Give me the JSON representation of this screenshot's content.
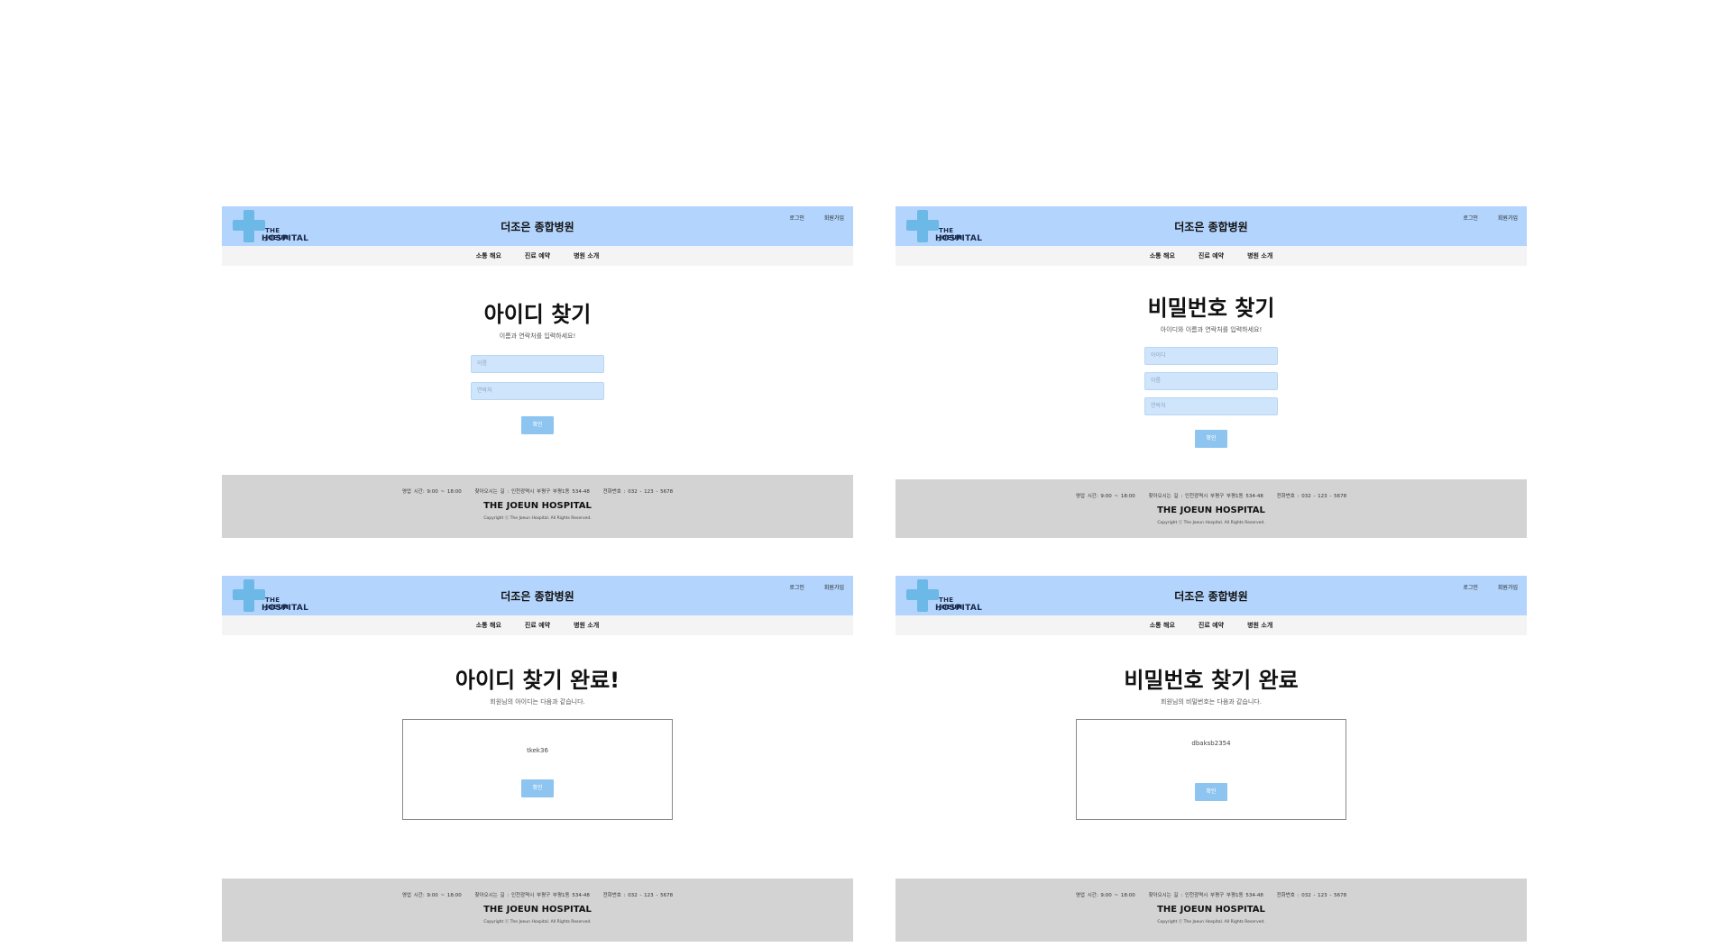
{
  "site": {
    "title": "더조은 종합병원",
    "logo_line1": "THE JOEUN",
    "logo_line2": "HOSPITAL",
    "login": "로그인",
    "signup": "회원가입",
    "nav": [
      "소통 해요",
      "진료 예약",
      "병원 소개"
    ]
  },
  "footer": {
    "hours": "영업 시간: 9:00 ~ 18:00",
    "address": "찾아오시는 길 : 인천광역시 부평구 부평1동 534-48",
    "phone": "전화번호 : 032 - 123 - 5678",
    "brand": "THE JOEUN HOSPITAL",
    "copyright": "Copyright ⓒ The Joeun Hospital. All Rights Reserved."
  },
  "find_id": {
    "title": "아이디 찾기",
    "subtitle": "이름과 연락처를 입력하세요!",
    "name_placeholder": "이름",
    "phone_placeholder": "연락처",
    "confirm": "확인"
  },
  "find_pw": {
    "title": "비밀번호 찾기",
    "subtitle": "아이디와 이름과 연락처를 입력하세요!",
    "id_placeholder": "아이디",
    "name_placeholder": "이름",
    "phone_placeholder": "연락처",
    "confirm": "확인"
  },
  "id_done": {
    "title": "아이디 찾기 완료!",
    "subtitle": "회원님의 아이디는 다음과 같습니다.",
    "value": "tkek36",
    "confirm": "확인"
  },
  "pw_done": {
    "title": "비밀번호 찾기 완료",
    "subtitle": "회원님의 비밀번호는 다음과 같습니다.",
    "value": "dbaksb2354",
    "confirm": "확인"
  },
  "colors": {
    "header": "#b3d4fc",
    "nav": "#f4f4f4",
    "footer": "#d3d3d3",
    "button": "#8ec5f0",
    "input": "#cfe5fb",
    "logo_cross": "#6cb8e6"
  },
  "icons": {
    "logo": "medical-cross-icon"
  }
}
